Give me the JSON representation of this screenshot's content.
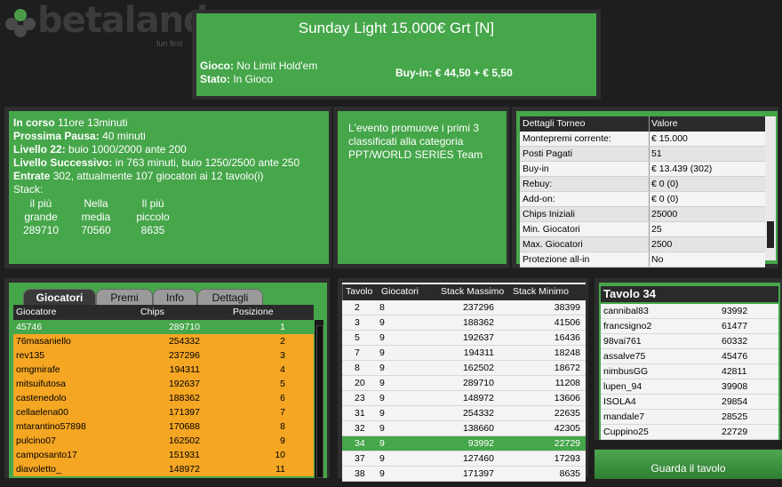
{
  "brand": {
    "name": "betaland",
    "tagline": "fun first"
  },
  "header": {
    "title": "Sunday Light 15.000€ Grt   [N]",
    "game_label": "Gioco:",
    "game_value": "No Limit Hold'em",
    "status_label": "Stato:",
    "status_value": "In Gioco",
    "buyin": "Buy-in: € 44,50 + € 5,50"
  },
  "info": {
    "running_label": "In corso",
    "running_value": "11ore 13minuti",
    "next_break_label": "Prossima Pausa:",
    "next_break_value": "40 minuti",
    "level_label": "Livello 22:",
    "level_value": "buio 1000/2000 ante 200",
    "next_level_label": "Livello Successivo:",
    "next_level_value": "in 763 minuti, buio 1250/2500 ante 250",
    "entries_label": "Entrate",
    "entries_value": "302, attualmente 107 giocatori ai 12 tavolo(i)",
    "stack_label": "Stack:",
    "stack": [
      {
        "l1": "il più",
        "l2": "grande",
        "v": "289710"
      },
      {
        "l1": "Nella",
        "l2": "media",
        "v": "70560"
      },
      {
        "l1": "Il più",
        "l2": "piccolo",
        "v": "8635"
      }
    ]
  },
  "promo": {
    "text": "L'evento promuove i primi 3 classificati alla categoria PPT/WORLD SERIES Team"
  },
  "details": {
    "headers": [
      "Dettagli Torneo",
      "Valore"
    ],
    "rows": [
      [
        "Montepremi corrente:",
        "€ 15.000"
      ],
      [
        "Posti Pagati",
        "51"
      ],
      [
        "Buy-in",
        "€ 13.439 (302)"
      ],
      [
        "Rebuy:",
        "€ 0 (0)"
      ],
      [
        "Add-on:",
        "€ 0 (0)"
      ],
      [
        "Chips Iniziali",
        "25000"
      ],
      [
        "Min. Giocatori",
        "25"
      ],
      [
        "Max. Giocatori",
        "2500"
      ],
      [
        "Protezione all-in",
        "No"
      ]
    ]
  },
  "tabs": [
    "Giocatori",
    "Premi",
    "Info",
    "Dettagli"
  ],
  "players": {
    "headers": [
      "Giocatore",
      "Chips",
      "Posizione"
    ],
    "rows": [
      [
        "45746",
        "289710",
        "1"
      ],
      [
        "76masaniello",
        "254332",
        "2"
      ],
      [
        "rev135",
        "237296",
        "3"
      ],
      [
        "omgmirafe",
        "194311",
        "4"
      ],
      [
        "mitsuifutosa",
        "192637",
        "5"
      ],
      [
        "castenedolo",
        "188362",
        "6"
      ],
      [
        "cellaelena00",
        "171397",
        "7"
      ],
      [
        "mtarantino57898",
        "170688",
        "8"
      ],
      [
        "pulcino07",
        "162502",
        "9"
      ],
      [
        "camposanto17",
        "151931",
        "10"
      ],
      [
        "diavoletto_",
        "148972",
        "11"
      ]
    ]
  },
  "tables": {
    "headers": [
      "Tavolo",
      "Giocatori",
      "Stack Massimo",
      "Stack Minimo"
    ],
    "rows": [
      [
        "2",
        "8",
        "237296",
        "38399"
      ],
      [
        "3",
        "9",
        "188362",
        "41506"
      ],
      [
        "5",
        "9",
        "192637",
        "16436"
      ],
      [
        "7",
        "9",
        "194311",
        "18248"
      ],
      [
        "8",
        "9",
        "162502",
        "18672"
      ],
      [
        "20",
        "9",
        "289710",
        "11208"
      ],
      [
        "23",
        "9",
        "148972",
        "13606"
      ],
      [
        "31",
        "9",
        "254332",
        "22635"
      ],
      [
        "32",
        "9",
        "138660",
        "42305"
      ],
      [
        "34",
        "9",
        "93992",
        "22729"
      ],
      [
        "37",
        "9",
        "127460",
        "17293"
      ],
      [
        "38",
        "9",
        "171397",
        "8635"
      ]
    ],
    "selected_index": 9
  },
  "table34": {
    "title": "Tavolo 34",
    "rows": [
      [
        "cannibal83",
        "93992"
      ],
      [
        "francsigno2",
        "61477"
      ],
      [
        "98vai761",
        "60332"
      ],
      [
        "assalve75",
        "45476"
      ],
      [
        "nimbusGG",
        "42811"
      ],
      [
        "lupen_94",
        "39908"
      ],
      [
        "ISOLA4",
        "29854"
      ],
      [
        "mandale7",
        "28525"
      ],
      [
        "Cuppino25",
        "22729"
      ]
    ]
  },
  "watch_button": "Guarda il tavolo"
}
